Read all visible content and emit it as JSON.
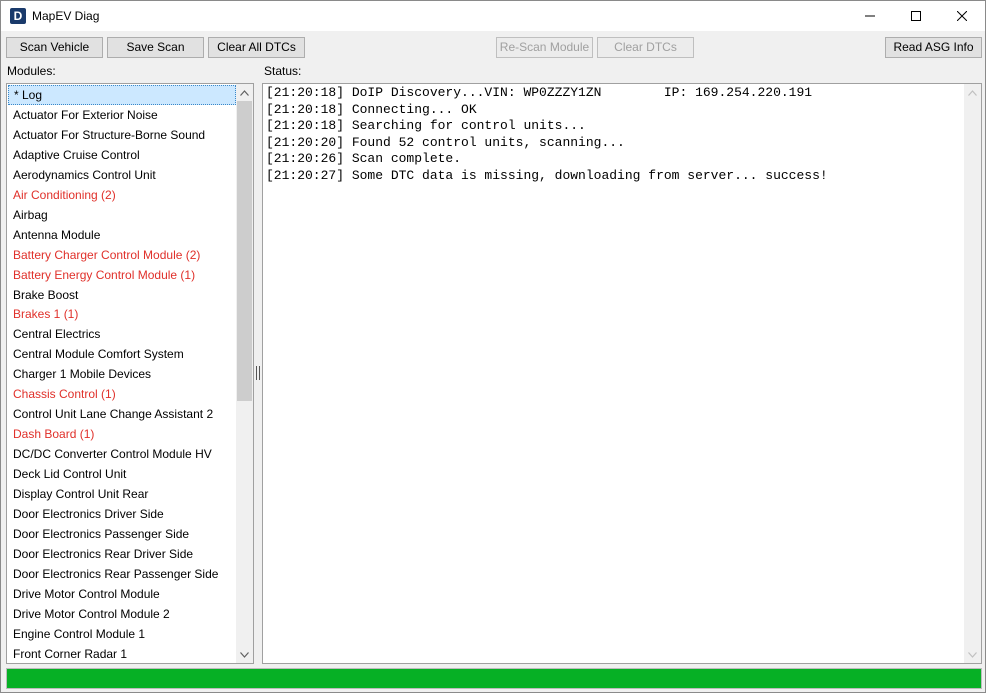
{
  "window": {
    "title": "MapEV Diag",
    "icon_letter": "D"
  },
  "toolbar": {
    "scan_vehicle": "Scan Vehicle",
    "save_scan": "Save Scan",
    "clear_all_dtcs": "Clear All DTCs",
    "rescan_module": "Re-Scan Module",
    "clear_dtcs": "Clear DTCs",
    "read_asg_info": "Read ASG Info"
  },
  "labels": {
    "modules": "Modules:",
    "status": "Status:"
  },
  "modules": [
    {
      "label": "* Log",
      "error": false,
      "selected": true
    },
    {
      "label": "Actuator For Exterior Noise",
      "error": false
    },
    {
      "label": "Actuator For Structure-Borne Sound",
      "error": false
    },
    {
      "label": "Adaptive Cruise Control",
      "error": false
    },
    {
      "label": "Aerodynamics Control Unit",
      "error": false
    },
    {
      "label": "Air Conditioning (2)",
      "error": true
    },
    {
      "label": "Airbag",
      "error": false
    },
    {
      "label": "Antenna Module",
      "error": false
    },
    {
      "label": "Battery Charger Control Module (2)",
      "error": true
    },
    {
      "label": "Battery Energy Control Module (1)",
      "error": true
    },
    {
      "label": "Brake Boost",
      "error": false
    },
    {
      "label": "Brakes 1 (1)",
      "error": true
    },
    {
      "label": "Central Electrics",
      "error": false
    },
    {
      "label": "Central Module Comfort System",
      "error": false
    },
    {
      "label": "Charger 1 Mobile Devices",
      "error": false
    },
    {
      "label": "Chassis Control (1)",
      "error": true
    },
    {
      "label": "Control Unit Lane Change Assistant 2",
      "error": false
    },
    {
      "label": "Dash Board (1)",
      "error": true
    },
    {
      "label": "DC/DC Converter Control Module HV",
      "error": false
    },
    {
      "label": "Deck Lid Control Unit",
      "error": false
    },
    {
      "label": "Display Control Unit Rear",
      "error": false
    },
    {
      "label": "Door Electronics Driver Side",
      "error": false
    },
    {
      "label": "Door Electronics Passenger Side",
      "error": false
    },
    {
      "label": "Door Electronics Rear Driver Side",
      "error": false
    },
    {
      "label": "Door Electronics Rear Passenger Side",
      "error": false
    },
    {
      "label": "Drive Motor Control Module",
      "error": false
    },
    {
      "label": "Drive Motor Control Module 2",
      "error": false
    },
    {
      "label": "Engine Control Module 1",
      "error": false
    },
    {
      "label": "Front Corner Radar 1",
      "error": false
    }
  ],
  "log": [
    "[21:20:18] DoIP Discovery...VIN: WP0ZZZY1ZN        IP: 169.254.220.191",
    "[21:20:18] Connecting... OK",
    "[21:20:18] Searching for control units...",
    "[21:20:20] Found 52 control units, scanning...",
    "[21:20:26] Scan complete.",
    "[21:20:27] Some DTC data is missing, downloading from server... success!"
  ],
  "progress": {
    "percent": 100,
    "color": "#06b025"
  },
  "colors": {
    "error_text": "#e0302a",
    "selection": "#cce8ff"
  }
}
